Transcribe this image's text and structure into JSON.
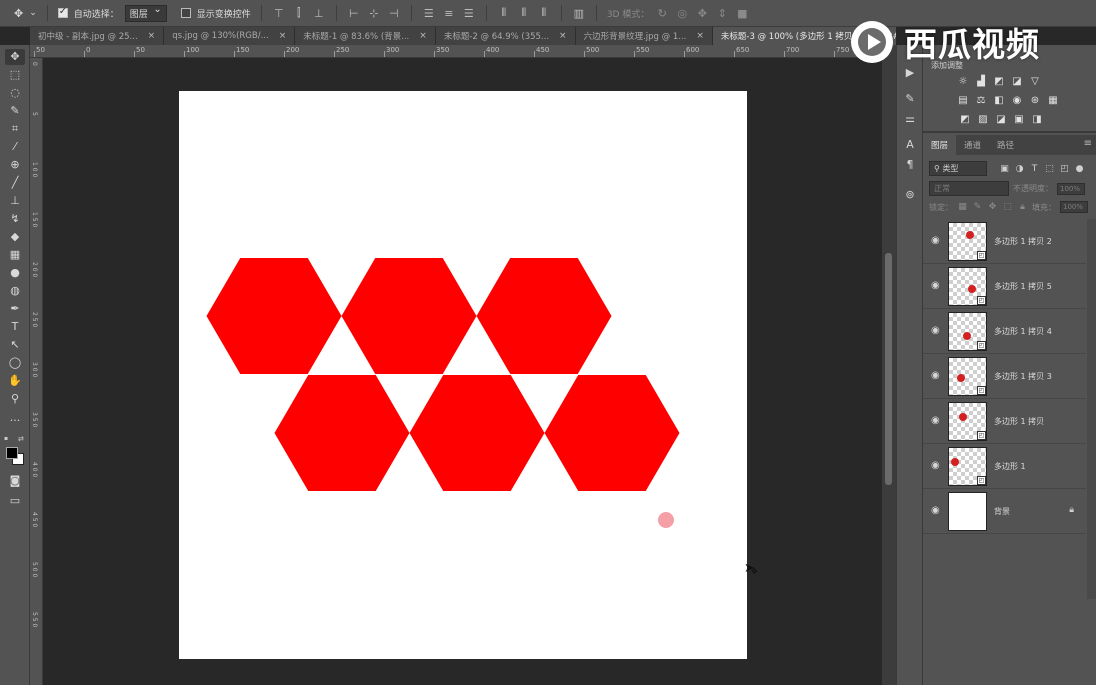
{
  "options_bar": {
    "move_tool_icon": "move-icon",
    "auto_select_label": "自动选择：",
    "auto_select_checked": true,
    "auto_select_target": "图层",
    "show_transform_label": "显示变换控件",
    "show_transform_checked": false,
    "mode_3d_label": "3D 模式："
  },
  "tabs": [
    {
      "label": "初中级 - 副本.jpg @ 25...",
      "active": false
    },
    {
      "label": "qs.jpg @ 130%(RGB/...",
      "active": false
    },
    {
      "label": "未标题-1 @ 83.6% (背景...",
      "active": false
    },
    {
      "label": "未标题-2 @ 64.9% (355...",
      "active": false
    },
    {
      "label": "六边形背景纹理.jpg @ 1...",
      "active": false
    },
    {
      "label": "未标题-3 @ 100% (多边形 1 拷贝 5, RGB/8#) *",
      "active": true
    }
  ],
  "ruler_top_labels": [
    "50",
    "0",
    "50",
    "100",
    "150",
    "200",
    "250",
    "300",
    "350",
    "400",
    "450",
    "500",
    "550",
    "600",
    "650",
    "700",
    "750",
    "800"
  ],
  "ruler_left_labels": [
    "0",
    "5",
    "1 0 0",
    "1 5 0",
    "2 0 0",
    "2 5 0",
    "3 0 0",
    "3 5 0",
    "4 0 0",
    "4 5 0",
    "5 0 0",
    "5 5 0"
  ],
  "canvas": {
    "hexagon_color": "#ff0000",
    "hexagons_top_row": 3,
    "hexagons_bottom_row": 3,
    "brush_cursor_color": "#f4a0a6"
  },
  "adjustments": {
    "title": "添加调整"
  },
  "layers_panel": {
    "tabs": [
      {
        "label": "图层",
        "active": true
      },
      {
        "label": "通道",
        "active": false
      },
      {
        "label": "路径",
        "active": false
      }
    ],
    "filter_label": "类型",
    "blend_mode": "正常",
    "opacity_label": "不透明度：",
    "opacity_value": "100%",
    "lock_label": "锁定：",
    "fill_label": "填充：",
    "fill_value": "100%",
    "layers": [
      {
        "name": "多边形 1 拷贝 2",
        "type": "shape",
        "dot": [
          0.55,
          0.32
        ]
      },
      {
        "name": "多边形 1 拷贝 5",
        "type": "shape",
        "dot": [
          0.6,
          0.55
        ]
      },
      {
        "name": "多边形 1 拷贝 4",
        "type": "shape",
        "dot": [
          0.45,
          0.6
        ]
      },
      {
        "name": "多边形 1 拷贝 3",
        "type": "shape",
        "dot": [
          0.3,
          0.5
        ]
      },
      {
        "name": "多边形 1 拷贝",
        "type": "shape",
        "dot": [
          0.35,
          0.35
        ]
      },
      {
        "name": "多边形 1",
        "type": "shape",
        "dot": [
          0.15,
          0.35
        ]
      },
      {
        "name": "背景",
        "type": "background",
        "locked": true
      }
    ]
  },
  "watermark": {
    "text": "西瓜视频"
  }
}
